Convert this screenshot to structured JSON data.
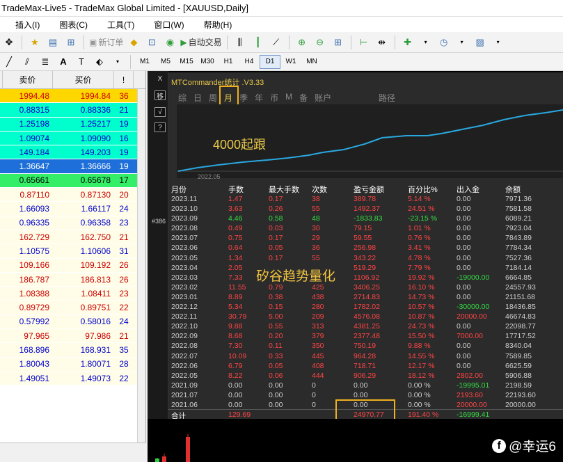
{
  "window": {
    "title": "TradeMax-Live5 - TradeMax Global Limited - [XAUUSD,Daily]"
  },
  "menu": [
    "插入(I)",
    "图表(C)",
    "工具(T)",
    "窗口(W)",
    "帮助(H)"
  ],
  "toolbar": {
    "new_order": "新订单",
    "auto_trade": "自动交易"
  },
  "timeframes": [
    "M1",
    "M5",
    "M15",
    "M30",
    "H1",
    "H4",
    "D1",
    "W1",
    "MN"
  ],
  "timeframe_selected": "D1",
  "market_watch": {
    "headers": {
      "bid": "卖价",
      "ask": "买价",
      "spread": "!"
    },
    "rows": [
      {
        "bid": "1994.48",
        "ask": "1994.84",
        "spread": "36",
        "color": "#ffd700",
        "text": "#cc0000"
      },
      {
        "bid": "0.88315",
        "ask": "0.88336",
        "spread": "21",
        "color": "#00ffcc",
        "text": "#0000cc"
      },
      {
        "bid": "1.25198",
        "ask": "1.25217",
        "spread": "19",
        "color": "#00ffcc",
        "text": "#0000cc"
      },
      {
        "bid": "1.09074",
        "ask": "1.09090",
        "spread": "16",
        "color": "#00ffcc",
        "text": "#0000cc"
      },
      {
        "bid": "149.184",
        "ask": "149.203",
        "spread": "19",
        "color": "#00ffcc",
        "text": "#0000cc"
      },
      {
        "bid": "1.36647",
        "ask": "1.36666",
        "spread": "19",
        "color": "#1e6fd9",
        "text": "#ffffff"
      },
      {
        "bid": "0.65661",
        "ask": "0.65678",
        "spread": "17",
        "color": "#33ee66",
        "text": "#000000"
      },
      {
        "bid": "0.87110",
        "ask": "0.87130",
        "spread": "20",
        "color": "#fffde8",
        "text": "#cc0000"
      },
      {
        "bid": "1.66093",
        "ask": "1.66117",
        "spread": "24",
        "color": "#fffde8",
        "text": "#0000cc"
      },
      {
        "bid": "0.96335",
        "ask": "0.96358",
        "spread": "23",
        "color": "#fffde8",
        "text": "#0000cc"
      },
      {
        "bid": "162.729",
        "ask": "162.750",
        "spread": "21",
        "color": "#fffde8",
        "text": "#cc0000"
      },
      {
        "bid": "1.10575",
        "ask": "1.10606",
        "spread": "31",
        "color": "#fffde8",
        "text": "#0000cc"
      },
      {
        "bid": "109.166",
        "ask": "109.192",
        "spread": "26",
        "color": "#fffde8",
        "text": "#cc0000"
      },
      {
        "bid": "186.787",
        "ask": "186.813",
        "spread": "26",
        "color": "#fffde8",
        "text": "#cc0000"
      },
      {
        "bid": "1.08388",
        "ask": "1.08411",
        "spread": "23",
        "color": "#fffde8",
        "text": "#cc0000"
      },
      {
        "bid": "0.89729",
        "ask": "0.89751",
        "spread": "22",
        "color": "#fffde8",
        "text": "#cc0000"
      },
      {
        "bid": "0.57992",
        "ask": "0.58016",
        "spread": "24",
        "color": "#fffde8",
        "text": "#0000cc"
      },
      {
        "bid": "97.965",
        "ask": "97.986",
        "spread": "21",
        "color": "#fffde8",
        "text": "#cc0000"
      },
      {
        "bid": "168.896",
        "ask": "168.931",
        "spread": "35",
        "color": "#fffde8",
        "text": "#0000cc"
      },
      {
        "bid": "1.80043",
        "ask": "1.80071",
        "spread": "28",
        "color": "#fffde8",
        "text": "#0000cc"
      },
      {
        "bid": "1.49051",
        "ask": "1.49073",
        "spread": "22",
        "color": "#fffde8",
        "text": "#0000cc"
      }
    ]
  },
  "chart_side": {
    "btn1": "X",
    "btn2": "移",
    "btn3": "√",
    "btn4": "?",
    "tag": "#386"
  },
  "commander": {
    "title": "MTCommander统计 .V3.33",
    "nav": [
      "综",
      "日",
      "周",
      "月",
      "季",
      "年",
      "币",
      "M",
      "备",
      "账户"
    ],
    "nav_selected": "月",
    "nav_path": "路径",
    "equity_start_label": "2022.05",
    "note_follow": "4000起跟",
    "note_quant": "矽谷趋势量化",
    "table": {
      "headers": [
        "月份",
        "手数",
        "最大手数",
        "次数",
        "盈亏金额",
        "百分比%",
        "出入金",
        "余额"
      ],
      "rows": [
        [
          "2023.11",
          "1.47",
          "0.17",
          "38",
          "389.78",
          "5.14 %",
          "0.00",
          "7971.36"
        ],
        [
          "2023.10",
          "3.63",
          "0.26",
          "55",
          "1492.37",
          "24.51 %",
          "0.00",
          "7581.58"
        ],
        [
          "2023.09",
          "4.46",
          "0.58",
          "48",
          "-1833.83",
          "-23.15 %",
          "0.00",
          "6089.21"
        ],
        [
          "2023.08",
          "0.49",
          "0.03",
          "30",
          "79.15",
          "1.01 %",
          "0.00",
          "7923.04"
        ],
        [
          "2023.07",
          "0.75",
          "0.17",
          "29",
          "59.55",
          "0.76 %",
          "0.00",
          "7843.89"
        ],
        [
          "2023.06",
          "0.64",
          "0.05",
          "36",
          "256.98",
          "3.41 %",
          "0.00",
          "7784.34"
        ],
        [
          "2023.05",
          "1.34",
          "0.17",
          "55",
          "343.22",
          "4.78 %",
          "0.00",
          "7527.36"
        ],
        [
          "2023.04",
          "2.05",
          "",
          "",
          "519.29",
          "7.79 %",
          "0.00",
          "7184.14"
        ],
        [
          "2023.03",
          "7.33",
          "",
          "",
          "1106.92",
          "19.92 %",
          "-19000.00",
          "6664.85"
        ],
        [
          "2023.02",
          "11.55",
          "0.79",
          "425",
          "3406.25",
          "16.10 %",
          "0.00",
          "24557.93"
        ],
        [
          "2023.01",
          "8.89",
          "0.38",
          "438",
          "2714.83",
          "14.73 %",
          "0.00",
          "21151.68"
        ],
        [
          "2022.12",
          "5.34",
          "0.15",
          "280",
          "1782.02",
          "10.57 %",
          "-30000.00",
          "18436.85"
        ],
        [
          "2022.11",
          "30.79",
          "5.00",
          "209",
          "4576.08",
          "10.87 %",
          "20000.00",
          "46674.83"
        ],
        [
          "2022.10",
          "9.88",
          "0.55",
          "313",
          "4381.25",
          "24.73 %",
          "0.00",
          "22098.77"
        ],
        [
          "2022.09",
          "8.68",
          "0.20",
          "379",
          "2377.48",
          "15.50 %",
          "7000.00",
          "17717.52"
        ],
        [
          "2022.08",
          "7.30",
          "0.11",
          "350",
          "750.19",
          "9.88 %",
          "0.00",
          "8340.04"
        ],
        [
          "2022.07",
          "10.09",
          "0.33",
          "445",
          "964.28",
          "14.55 %",
          "0.00",
          "7589.85"
        ],
        [
          "2022.06",
          "6.79",
          "0.05",
          "408",
          "718.71",
          "12.17 %",
          "0.00",
          "6625.59"
        ],
        [
          "2022.05",
          "8.22",
          "0.06",
          "444",
          "906.29",
          "18.12 %",
          "2802.00",
          "5906.88"
        ],
        [
          "2021.09",
          "0.00",
          "0.00",
          "0",
          "0.00",
          "0.00 %",
          "-19995.01",
          "2198.59"
        ],
        [
          "2021.07",
          "0.00",
          "0.00",
          "0",
          "0.00",
          "0.00 %",
          "2193.60",
          "22193.60"
        ],
        [
          "2021.06",
          "0.00",
          "0.00",
          "0",
          "0.00",
          "0.00 %",
          "20000.00",
          "20000.00"
        ]
      ],
      "totals": {
        "label": "合计",
        "lots": "129.69",
        "pnl": "24970.77",
        "pct": "191.40 %",
        "flow": "-16999.41"
      }
    },
    "colors": {
      "accent": "#e8c84a",
      "profit": "#ff4444",
      "loss": "#33dd44",
      "curve": "#29a8e0",
      "highlight": "#f0b020"
    }
  },
  "watermark": {
    "icon": "facebook-icon",
    "text": "@幸运6"
  }
}
